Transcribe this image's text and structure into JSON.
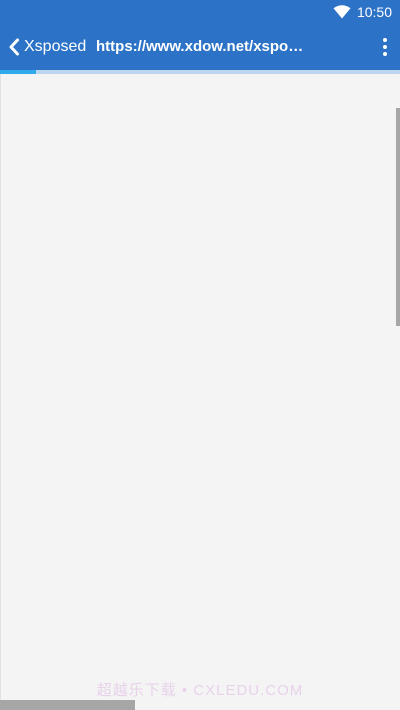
{
  "status_bar": {
    "time": "10:50",
    "wifi_icon": "wifi-icon"
  },
  "app_bar": {
    "back_icon": "chevron-left-icon",
    "back_label": "Xsposed",
    "url": "https://www.xdow.net/xsposed/",
    "menu_icon": "more-vert-icon",
    "background_color": "#2c73c7"
  },
  "page_load": {
    "progress_percent": 9,
    "track_color": "#bcd6ef",
    "fill_color": "#2fa8ec"
  },
  "scrollbars": {
    "vertical_position_fraction": 0.05,
    "horizontal_position_fraction": 0.0
  },
  "watermark": {
    "text": "超越乐下载 • CXLEDU.COM"
  }
}
